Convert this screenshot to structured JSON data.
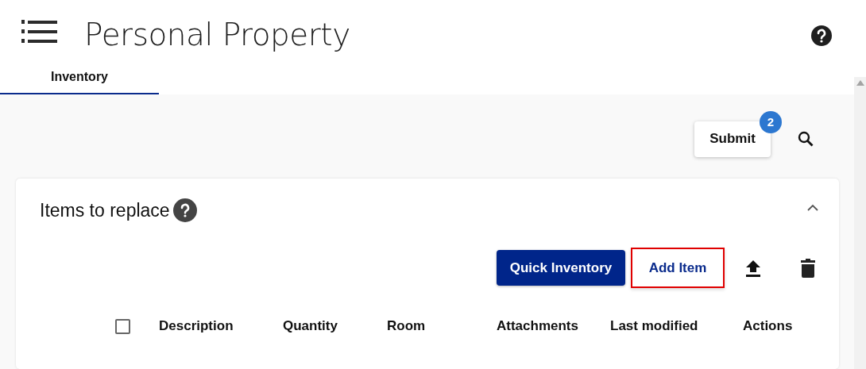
{
  "header": {
    "title": "Personal Property"
  },
  "tabs": [
    {
      "label": "Inventory",
      "selected": true
    }
  ],
  "toolbar": {
    "submit": {
      "label": "Submit",
      "badge": "2"
    }
  },
  "card": {
    "title": "Items to replace",
    "expanded": true,
    "actions": [
      {
        "kind": "primary",
        "label": "Quick Inventory",
        "highlighted": false
      },
      {
        "kind": "outline",
        "label": "Add Item",
        "highlighted": true
      }
    ],
    "table": {
      "select_all": {
        "checked": false
      },
      "columns": [
        "Description",
        "Quantity",
        "Room",
        "Attachments",
        "Last modified",
        "Actions"
      ]
    }
  }
}
